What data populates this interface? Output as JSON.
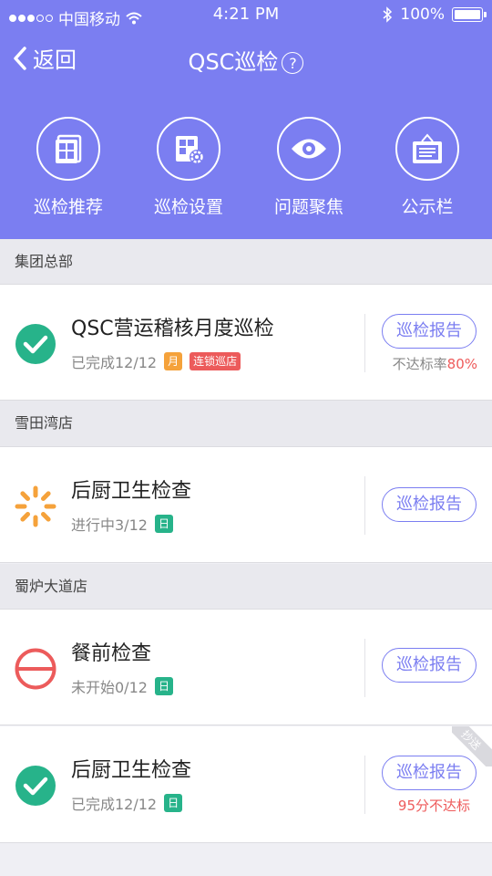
{
  "status_bar": {
    "carrier": "中国移动",
    "time": "4:21 PM",
    "battery": "100%"
  },
  "nav": {
    "back_label": "返回",
    "title": "QSC巡检",
    "help": "?"
  },
  "quick_actions": [
    {
      "label": "巡检推荐",
      "icon": "cards-icon"
    },
    {
      "label": "巡检设置",
      "icon": "settings-grid-icon"
    },
    {
      "label": "问题聚焦",
      "icon": "eye-icon"
    },
    {
      "label": "公示栏",
      "icon": "bulletin-board-icon"
    }
  ],
  "sections": [
    {
      "title": "集团总部"
    },
    {
      "title": "雪田湾店"
    },
    {
      "title": "蜀炉大道店"
    }
  ],
  "cards": [
    {
      "title": "QSC营运稽核月度巡检",
      "progress": "已完成12/12",
      "status": "completed",
      "tags": [
        "月",
        "连锁巡店"
      ],
      "report_label": "巡检报告",
      "note_prefix": "不达标率",
      "note_value": "80%"
    },
    {
      "title": "后厨卫生检查",
      "progress": "进行中3/12",
      "status": "in-progress",
      "tags": [
        "日"
      ],
      "report_label": "巡检报告"
    },
    {
      "title": "餐前检查",
      "progress": "未开始0/12",
      "status": "not-started",
      "tags": [
        "日"
      ],
      "report_label": "巡检报告"
    },
    {
      "title": "后厨卫生检查",
      "progress": "已完成12/12",
      "status": "completed",
      "tags": [
        "日"
      ],
      "report_label": "巡检报告",
      "note": "95分不达标",
      "ribbon": "抄送"
    }
  ],
  "colors": {
    "header": "#7b7ef1",
    "accent": "#7b7ef1",
    "success": "#27b38a",
    "warning": "#f5a23b",
    "danger": "#ec5b5b"
  }
}
